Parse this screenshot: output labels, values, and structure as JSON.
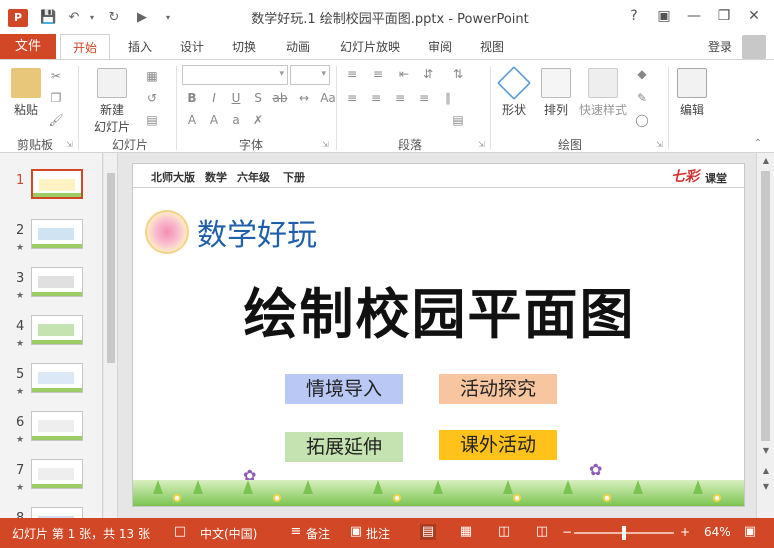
{
  "window": {
    "title": "数学好玩.1 绘制校园平面图.pptx - PowerPoint",
    "app_icon_label": "P",
    "help": "?",
    "ribbon_display": "▣",
    "minimize": "—",
    "restore": "❐",
    "close": "✕"
  },
  "tabs": {
    "file": "文件",
    "items": [
      "开始",
      "插入",
      "设计",
      "切换",
      "动画",
      "幻灯片放映",
      "审阅",
      "视图"
    ],
    "login": "登录"
  },
  "ribbon": {
    "groups": [
      "剪贴板",
      "幻灯片",
      "字体",
      "段落",
      "绘图",
      "编辑"
    ],
    "paste": "粘贴",
    "new_slide_line1": "新建",
    "new_slide_line2": "幻灯片",
    "shape": "形状",
    "arrange": "排列",
    "quick_styles": "快速样式",
    "edit": "编辑",
    "font_name": "",
    "font_size": ""
  },
  "thumbnails": [
    {
      "num": "1",
      "star": ""
    },
    {
      "num": "2",
      "star": "★"
    },
    {
      "num": "3",
      "star": "★"
    },
    {
      "num": "4",
      "star": "★"
    },
    {
      "num": "5",
      "star": "★"
    },
    {
      "num": "6",
      "star": "★"
    },
    {
      "num": "7",
      "star": "★"
    },
    {
      "num": "8",
      "star": ""
    }
  ],
  "slide": {
    "meta": [
      "北师大版",
      "数学",
      "六年级",
      "下册"
    ],
    "brand": "七彩",
    "brand2": "课堂",
    "subtitle": "数学好玩",
    "title": "绘制校园平面图",
    "buttons": [
      {
        "label": "情境导入",
        "color": "#b9c8f5"
      },
      {
        "label": "活动探究",
        "color": "#f7c59f"
      },
      {
        "label": "拓展延伸",
        "color": "#c5e3b1"
      },
      {
        "label": "课外活动",
        "color": "#ffc21a"
      }
    ]
  },
  "status": {
    "slide_info": "幻灯片 第 1 张，共 13 张",
    "language": "中文(中国)",
    "notes": "备注",
    "comments": "批注",
    "zoom": "64%",
    "zoom_fraction": 0.5
  },
  "colors": {
    "accent": "#d24726"
  }
}
